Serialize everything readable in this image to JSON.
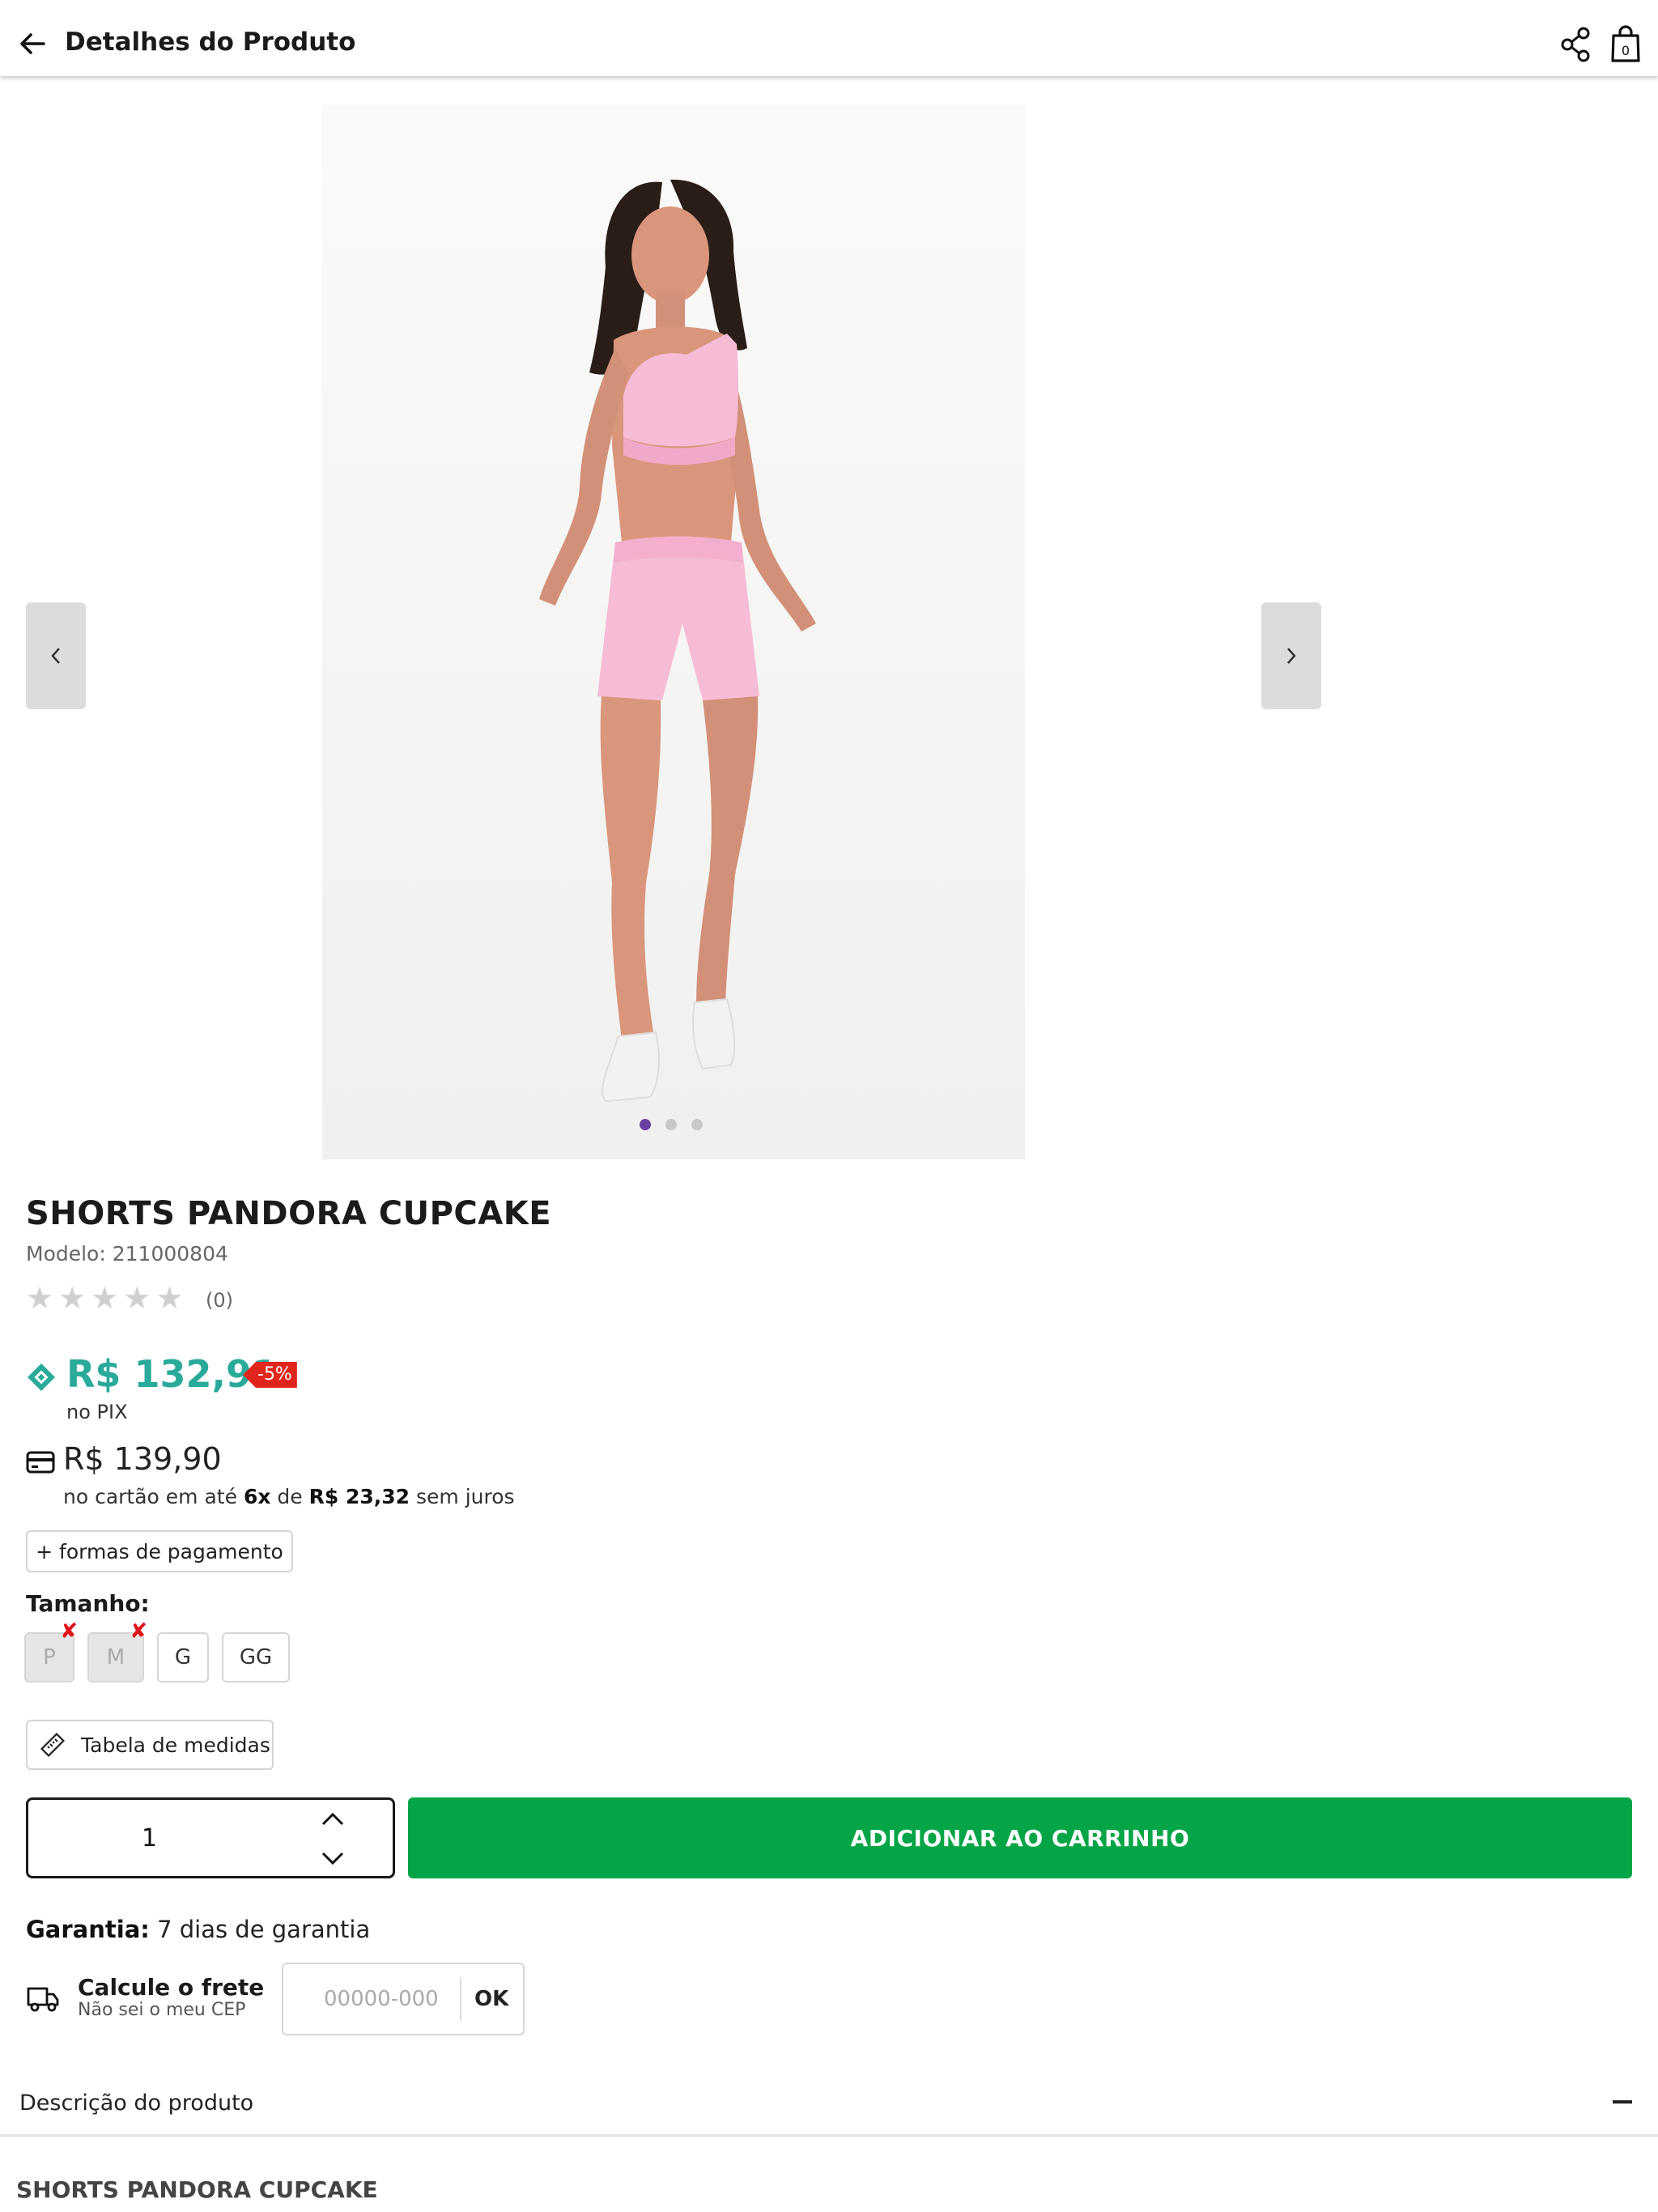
{
  "header": {
    "title": "Detalhes do Produto",
    "icons": [
      "back-arrow-icon",
      "share-icon",
      "shopping-bag-icon"
    ],
    "bag_count": "0"
  },
  "gallery": {
    "image_count": 3,
    "active_index": 0,
    "photo_description_icon": "product-photo"
  },
  "product": {
    "name": "SHORTS PANDORA CUPCAKE",
    "model": "Modelo: 211000804",
    "rating_stars": 0,
    "review_count": "(0)"
  },
  "pricing": {
    "pix_price": "R$ 132,91",
    "pix_discount": "-5%",
    "pix_label": "no PIX",
    "card_price": "R$ 139,90",
    "installments_prefix": "no cartão em até ",
    "installments_count": "6x",
    "installments_mid": " de ",
    "installments_value": "R$ 23,32",
    "installments_suffix": " sem juros",
    "payment_methods_button": "+ formas de pagamento",
    "colors": {
      "pix": "#2aaa9a",
      "discount": "#e0261c"
    }
  },
  "sizes": {
    "label": "Tamanho:",
    "options": [
      {
        "label": "P",
        "available": false
      },
      {
        "label": "M",
        "available": false
      },
      {
        "label": "G",
        "available": true
      },
      {
        "label": "GG",
        "available": true
      }
    ],
    "unavailable_mark": "✘"
  },
  "measurements_button": "Tabela de medidas",
  "quantity": {
    "value": "1"
  },
  "add_to_cart": {
    "label": "ADICIONAR AO CARRINHO",
    "color": "#03a546"
  },
  "warranty": {
    "label": "Garantia:",
    "value": " 7 dias de garantia"
  },
  "shipping": {
    "title": "Calcule o frete",
    "link": "Não sei o meu CEP",
    "cep_placeholder": "00000-000",
    "ok_label": "OK"
  },
  "description": {
    "header": "Descrição do produto",
    "title": "SHORTS PANDORA CUPCAKE"
  }
}
